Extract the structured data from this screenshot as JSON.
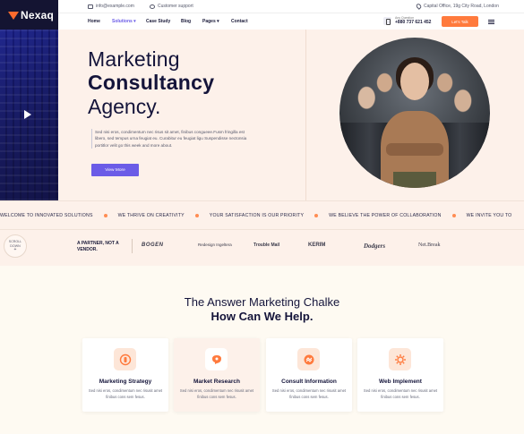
{
  "brand": {
    "logo_text": "Nexaq",
    "accent_color": "#ff7a3d",
    "primary_color": "#6b5ce7",
    "dark_color": "#141432"
  },
  "topbar": {
    "email": "info@example.com",
    "support": "Customer support",
    "address": "Capital Office, 19g City Road, London"
  },
  "nav": {
    "items": [
      {
        "label": "Home"
      },
      {
        "label": "Solutions ▾"
      },
      {
        "label": "Case Study"
      },
      {
        "label": "Blog"
      },
      {
        "label": "Pages ▾"
      },
      {
        "label": "Contact"
      }
    ],
    "phone_label": "Any Question",
    "phone_number": "+880 737 621 452",
    "cta_label": "Let's Talk"
  },
  "hero": {
    "title_line_1": "Marketing",
    "title_line_2": "Consultancy",
    "title_line_3": "Agency.",
    "description": "Sed nisi eros, condimentum nec risus sit amet, finibus congueee.Fusm fringilla est libero, sed tempus urna feugiat eu. Curabitur eu feugiat ligu Suspendisse nectonsia portitlor velit go this week and more about.",
    "button_label": "View More",
    "play_icon": "play-icon"
  },
  "marquee": {
    "items": [
      "WELCOME TO INNOVATED SOLUTIONS",
      "WE THRIVE ON CREATIVITY",
      "YOUR SATISFACTION IS OUR PRIORITY",
      "WE BELIEVE THE POWER OF COLLABORATION",
      "WE INVITE YOU TO"
    ]
  },
  "partners": {
    "scroll_label_1": "SCROLL",
    "scroll_label_2": "DOWN",
    "label": "A PARTNER, NOT A VENDOR.",
    "logos": [
      "BOGEN",
      "Redesign Ingeltera",
      "Trouble Mail",
      "KERIM",
      "Dodgers",
      "Net.Break"
    ]
  },
  "services": {
    "title_line_1": "The Answer Marketing Chalke",
    "title_line_2": "How Can We Help.",
    "cards": [
      {
        "title": "Marketing Strategy",
        "desc": "Sed nisi eros, condimentum nec risusit amet finibus cons sem fesus.",
        "icon": "strategy-icon"
      },
      {
        "title": "Market Research",
        "desc": "Sed nisi eros, condimentum nec risusit amet finibus cons sem fesus.",
        "icon": "research-icon"
      },
      {
        "title": "Consult Information",
        "desc": "Sed nisi eros, condimentum nec risusit amet finibus cons sem fesus.",
        "icon": "consult-icon"
      },
      {
        "title": "Web Implement",
        "desc": "Sed nisi eros, condimentum nec risusit amet finibus cons sem fesus.",
        "icon": "web-icon"
      }
    ]
  }
}
